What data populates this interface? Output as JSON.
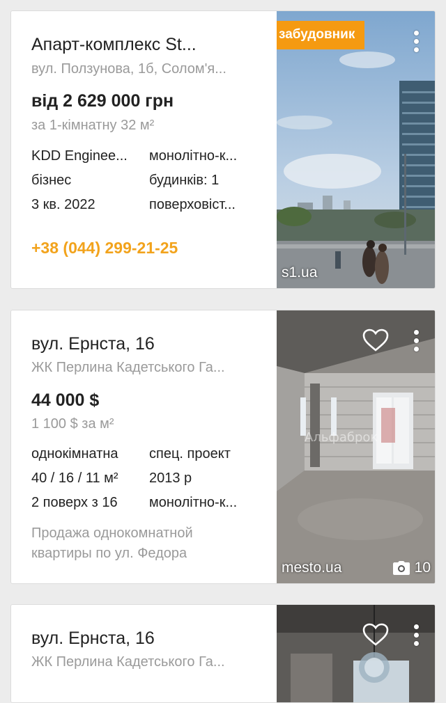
{
  "listings": [
    {
      "title": "Апарт-комплекс St...",
      "address": "вул. Ползунова, 1б, Солом'я...",
      "price": "від 2 629 000 грн",
      "price_sub": "за 1-кімнатну 32 м²",
      "specs_left": [
        "KDD Enginee...",
        "бізнес",
        "3 кв. 2022"
      ],
      "specs_right": [
        "монолітно-к...",
        "будинків: 1",
        "поверховіст..."
      ],
      "phone": "+38 (044) 299-21-25",
      "badge": "забудовник",
      "source": "s1.ua",
      "icons": [
        "more-vert-icon"
      ]
    },
    {
      "title": "вул. Ернста, 16",
      "address": "ЖК Перлина Кадетського Га...",
      "price": "44 000 $",
      "price_sub": "1 100 $ за м²",
      "specs_left": [
        "однокімнатна",
        "40 / 16 / 11 м²",
        "2 поверх з 16"
      ],
      "specs_right": [
        "спец. проект",
        "2013 р",
        "монолітно-к..."
      ],
      "description": "Продажа однокомнатной квартиры по ул. Федора",
      "source": "mesto.ua",
      "photo_count": "10",
      "icons": [
        "heart-icon",
        "more-vert-icon",
        "camera-icon"
      ]
    },
    {
      "title": "вул. Ернста, 16",
      "address": "ЖК Перлина Кадетського Га...",
      "icons": [
        "heart-icon",
        "more-vert-icon"
      ]
    }
  ],
  "colors": {
    "accent": "#f59a11",
    "phone": "#f2a31c",
    "muted": "#9a9a9a",
    "text": "#222222"
  }
}
